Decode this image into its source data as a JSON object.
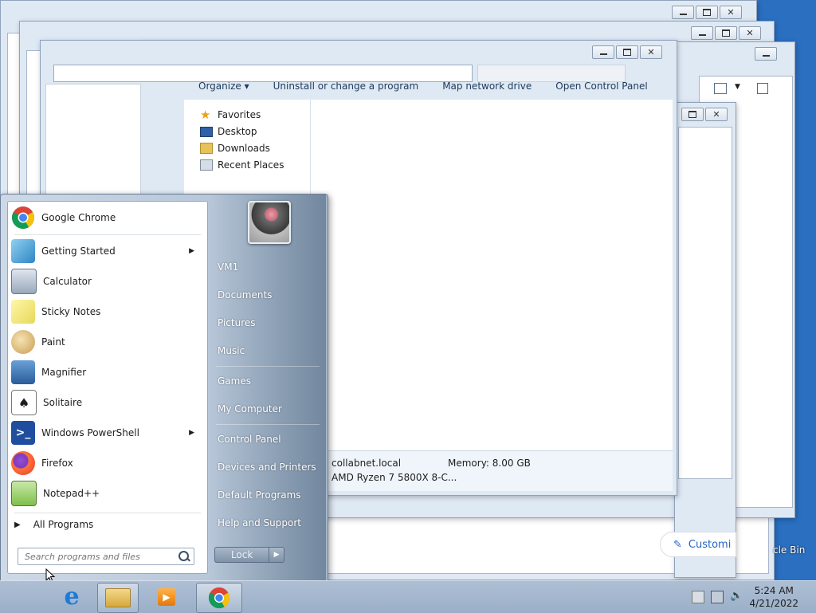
{
  "explorer": {
    "toolbar": [
      "Organize ▾",
      "Uninstall or change a program",
      "Map network drive",
      "Open Control Panel"
    ],
    "favorites": [
      "Favorites",
      "Desktop",
      "Downloads",
      "Recent Places"
    ],
    "details": {
      "domain": "collabnet.local",
      "memory": "Memory: 8.00 GB",
      "processor": "AMD Ryzen 7 5800X 8-C..."
    }
  },
  "start_menu": {
    "programs": [
      {
        "label": "Google Chrome",
        "icon": "chrome-icon",
        "submenu": false
      },
      {
        "label": "Getting Started",
        "icon": "getting-started-icon",
        "submenu": true
      },
      {
        "label": "Calculator",
        "icon": "calculator-icon",
        "submenu": false
      },
      {
        "label": "Sticky Notes",
        "icon": "sticky-notes-icon",
        "submenu": false
      },
      {
        "label": "Paint",
        "icon": "paint-icon",
        "submenu": false
      },
      {
        "label": "Magnifier",
        "icon": "magnifier-icon",
        "submenu": false
      },
      {
        "label": "Solitaire",
        "icon": "solitaire-icon",
        "submenu": false
      },
      {
        "label": "Windows PowerShell",
        "icon": "powershell-icon",
        "submenu": true
      },
      {
        "label": "Firefox",
        "icon": "firefox-icon",
        "submenu": false
      },
      {
        "label": "Notepad++",
        "icon": "notepadpp-icon",
        "submenu": false
      }
    ],
    "all_programs": "All Programs",
    "search_placeholder": "Search programs and files",
    "right_links": [
      "VM1",
      "Documents",
      "Pictures",
      "Music",
      "Games",
      "My Computer",
      "Control Panel",
      "Devices and Printers",
      "Default Programs",
      "Help and Support"
    ],
    "lock_label": "Lock"
  },
  "background": {
    "customize_label": "Customi",
    "recycle_label": "cle Bin"
  },
  "taskbar": {
    "apps": [
      "internet-explorer-icon",
      "file-explorer-icon",
      "media-player-icon",
      "chrome-icon"
    ],
    "time": "5:24 AM",
    "date": "4/21/2022"
  }
}
